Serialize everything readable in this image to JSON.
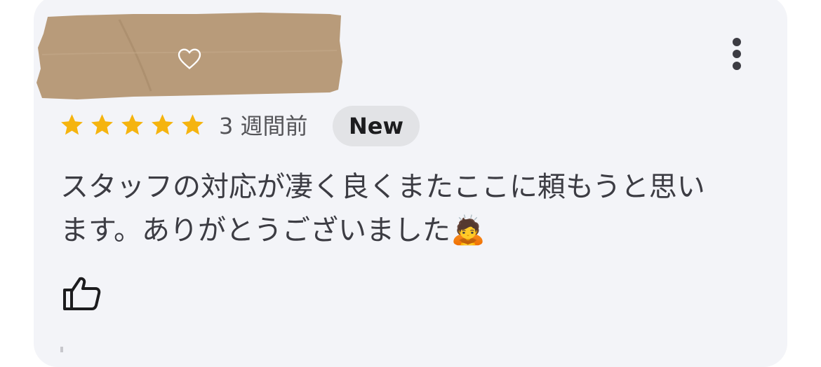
{
  "review": {
    "rating_value": 5,
    "rating_max": 5,
    "time_ago": "3 週間前",
    "badge": "New",
    "text_line1": "スタッフの対応が凄く良くまたここに頼もうと思い",
    "text_line2": "ます。ありがとうございました🙇"
  },
  "icons": {
    "more": "more-vertical-icon",
    "heart": "heart-outline-icon",
    "like": "thumbs-up-outline-icon",
    "star": "star-filled-icon"
  },
  "colors": {
    "card_background": "#f3f4f8",
    "star": "#f5b40f",
    "redaction_tape": "#b89b7a",
    "badge_background": "#e2e3e6",
    "text": "#3c3c43"
  }
}
